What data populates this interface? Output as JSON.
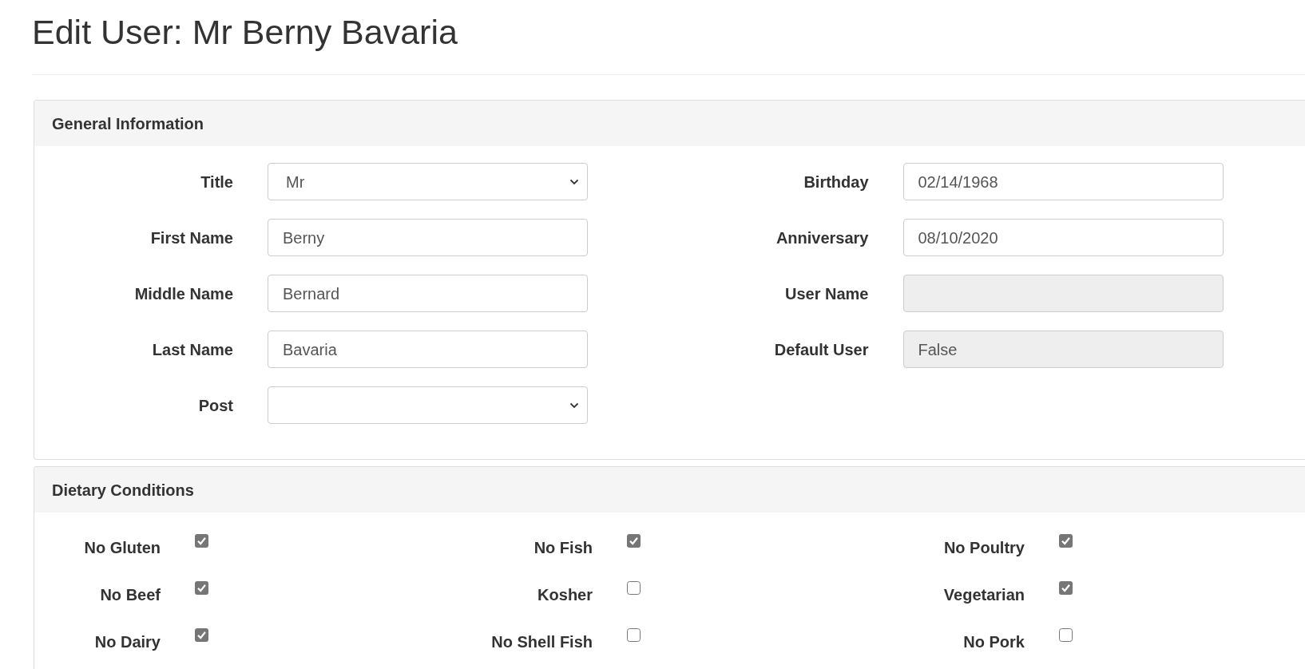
{
  "page_title": "Edit User: Mr Berny Bavaria",
  "general_information": {
    "heading": "General Information",
    "columns": [
      {
        "fields": [
          {
            "label": "Title",
            "kind": "select",
            "value": "Mr",
            "disabled": false
          },
          {
            "label": "First Name",
            "kind": "text",
            "value": "Berny",
            "disabled": false
          },
          {
            "label": "Middle Name",
            "kind": "text",
            "value": "Bernard",
            "disabled": false
          },
          {
            "label": "Last Name",
            "kind": "text",
            "value": "Bavaria",
            "disabled": false
          },
          {
            "label": "Post",
            "kind": "select",
            "disabled": false
          }
        ]
      },
      {
        "fields": [
          {
            "label": "Birthday",
            "kind": "text",
            "value": "02/14/1968",
            "disabled": false
          },
          {
            "label": "Anniversary",
            "kind": "text",
            "value": "08/10/2020",
            "disabled": false
          },
          {
            "label": "User Name",
            "kind": "text",
            "disabled": true
          },
          {
            "label": "Default User",
            "kind": "text",
            "value": "False",
            "disabled": true
          }
        ]
      }
    ]
  },
  "dietary_conditions": {
    "heading": "Dietary Conditions",
    "items": [
      {
        "label": "No Gluten",
        "checked": true
      },
      {
        "label": "No Fish",
        "checked": true
      },
      {
        "label": "No Poultry",
        "checked": true
      },
      {
        "label": "No Beef",
        "checked": true
      },
      {
        "label": "Kosher",
        "checked": false
      },
      {
        "label": "Vegetarian",
        "checked": true
      },
      {
        "label": "No Dairy",
        "checked": true
      },
      {
        "label": "No Shell Fish",
        "checked": false
      },
      {
        "label": "No Pork",
        "checked": false
      }
    ]
  }
}
